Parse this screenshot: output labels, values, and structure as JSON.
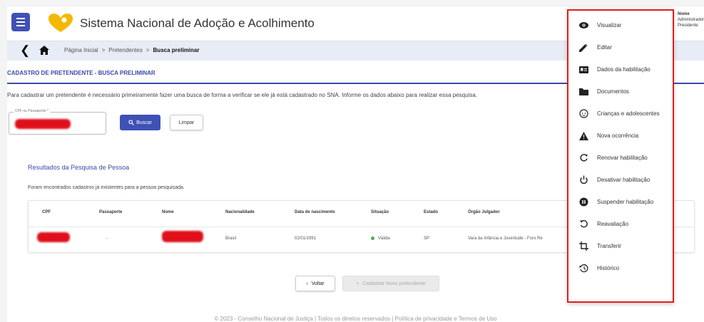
{
  "header": {
    "menu_icon": "hamburger-menu-icon",
    "logo": "heart-logo",
    "title": "Sistema Nacional de Adoção e Acolhimento",
    "user": {
      "line1": "Nome",
      "line2": "Administrador CNJ",
      "line3": "Presidente"
    }
  },
  "breadcrumb": {
    "items": [
      "Página Inicial",
      "Pretendentes",
      "Busca preliminar"
    ],
    "separator": ">"
  },
  "page": {
    "section_title": "CADASTRO DE PRETENDENTE - BUSCA PRELIMINAR",
    "instructions": "Para cadastrar um pretendente é necessário primeiramente fazer uma busca de forma a verificar se ele já está cadastrado no SNA. Informe os dados abaixo para realizar essa pesquisa.",
    "search": {
      "label": "CPF ou Passaporte *",
      "buscar_label": "Buscar",
      "limpar_label": "Limpar"
    },
    "results": {
      "title": "Resultados da Pesquisa de Pessoa",
      "message": "Foram encontrados cadastros já existentes para a pessoa pesquisada.",
      "columns": [
        "CPF",
        "Passaporte",
        "Nome",
        "Nacionalidade",
        "Data de nascimento",
        "Situação",
        "Estado",
        "Órgão Julgador"
      ],
      "rows": [
        {
          "cpf": "",
          "passaporte": "-",
          "nome": "",
          "nacionalidade": "Brasil",
          "data_nascimento": "02/01/1991",
          "situacao": "Válida",
          "estado": "SP",
          "orgao": "Vara da Infância e Juventude - Foro Re"
        }
      ]
    },
    "voltar_label": "Voltar",
    "cadastrar_label": "Cadastrar Novo pretendente",
    "footer": "© 2023 - Conselho Nacional de Justiça | Todos os direitos reservados | Política de privacidade e Termos de Uso"
  },
  "context_menu": {
    "items": [
      {
        "label": "Visualizar",
        "icon": "eye-icon"
      },
      {
        "label": "Editar",
        "icon": "pencil-icon"
      },
      {
        "label": "Dados da habilitação",
        "icon": "id-card-icon"
      },
      {
        "label": "Documentos",
        "icon": "folder-icon"
      },
      {
        "label": "Crianças e adolescentes",
        "icon": "child-face-icon"
      },
      {
        "label": "Nova ocorrência",
        "icon": "warning-icon"
      },
      {
        "label": "Renovar habilitação",
        "icon": "refresh-icon"
      },
      {
        "label": "Desativar habilitação",
        "icon": "power-icon"
      },
      {
        "label": "Suspender habilitação",
        "icon": "pause-circle-icon"
      },
      {
        "label": "Reavaliação",
        "icon": "redo-icon"
      },
      {
        "label": "Transferir",
        "icon": "crop-transfer-icon"
      },
      {
        "label": "Histórico",
        "icon": "history-icon"
      }
    ]
  },
  "colors": {
    "primary": "#3f51b5",
    "accent_title": "#3949ab",
    "highlight_border": "#e31b1b",
    "redaction": "#e0101a",
    "status_ok": "#4caf50",
    "logo": "#f5b800"
  }
}
